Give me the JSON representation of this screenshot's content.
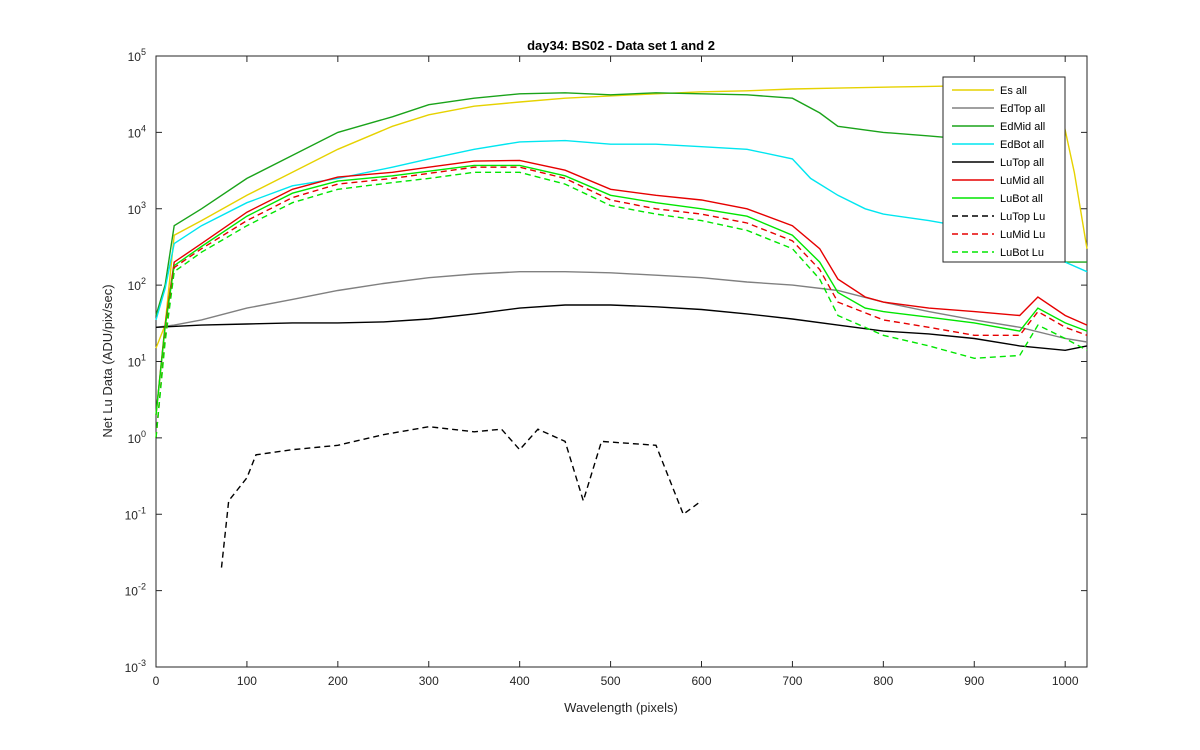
{
  "chart_data": {
    "type": "line",
    "title": "day34: BS02 - Data set 1 and 2",
    "xlabel": "Wavelength (pixels)",
    "ylabel": "Net Lu Data (ADU/pix/sec)",
    "xlim": [
      0,
      1024
    ],
    "ylim": [
      0.001,
      100000
    ],
    "yscale": "log",
    "x_ticks": [
      "0",
      "100",
      "200",
      "300",
      "400",
      "500",
      "600",
      "700",
      "800",
      "900",
      "1000"
    ],
    "y_tick_bases": [
      "10",
      "10",
      "10",
      "10",
      "10",
      "10",
      "10",
      "10",
      "10"
    ],
    "y_tick_exponents": [
      "-3",
      "-2",
      "-1",
      "0",
      "1",
      "2",
      "3",
      "4",
      "5"
    ],
    "grid": false,
    "legend_position": "top-right",
    "series": [
      {
        "name": "Es  all",
        "color": "#e6d200",
        "style": "solid",
        "points": [
          [
            0,
            15
          ],
          [
            10,
            30
          ],
          [
            20,
            450
          ],
          [
            50,
            700
          ],
          [
            100,
            1500
          ],
          [
            150,
            3000
          ],
          [
            200,
            6000
          ],
          [
            260,
            12000
          ],
          [
            300,
            17000
          ],
          [
            350,
            22000
          ],
          [
            400,
            25000
          ],
          [
            450,
            28000
          ],
          [
            500,
            30000
          ],
          [
            550,
            32000
          ],
          [
            600,
            34000
          ],
          [
            650,
            35000
          ],
          [
            700,
            37000
          ],
          [
            750,
            38000
          ],
          [
            800,
            39000
          ],
          [
            850,
            40000
          ],
          [
            900,
            41000
          ],
          [
            950,
            40000
          ],
          [
            990,
            38000
          ],
          [
            1010,
            3000
          ],
          [
            1024,
            300
          ]
        ]
      },
      {
        "name": "EdTop  all",
        "color": "#808080",
        "style": "solid",
        "points": [
          [
            0,
            28
          ],
          [
            20,
            30
          ],
          [
            50,
            35
          ],
          [
            100,
            50
          ],
          [
            150,
            65
          ],
          [
            200,
            85
          ],
          [
            250,
            105
          ],
          [
            300,
            125
          ],
          [
            350,
            140
          ],
          [
            400,
            150
          ],
          [
            450,
            150
          ],
          [
            500,
            145
          ],
          [
            550,
            135
          ],
          [
            600,
            125
          ],
          [
            650,
            110
          ],
          [
            700,
            100
          ],
          [
            750,
            85
          ],
          [
            800,
            60
          ],
          [
            850,
            45
          ],
          [
            900,
            35
          ],
          [
            950,
            28
          ],
          [
            1000,
            20
          ],
          [
            1024,
            18
          ]
        ]
      },
      {
        "name": "EdMid  all",
        "color": "#1aa31a",
        "style": "solid",
        "points": [
          [
            0,
            40
          ],
          [
            10,
            100
          ],
          [
            20,
            600
          ],
          [
            50,
            1000
          ],
          [
            100,
            2500
          ],
          [
            150,
            5000
          ],
          [
            200,
            10000
          ],
          [
            260,
            16000
          ],
          [
            300,
            23000
          ],
          [
            350,
            28000
          ],
          [
            400,
            32000
          ],
          [
            450,
            33000
          ],
          [
            500,
            31000
          ],
          [
            550,
            33000
          ],
          [
            600,
            32000
          ],
          [
            650,
            31000
          ],
          [
            700,
            28000
          ],
          [
            730,
            18000
          ],
          [
            750,
            12000
          ],
          [
            800,
            10000
          ],
          [
            850,
            9000
          ],
          [
            900,
            8000
          ],
          [
            950,
            7000
          ],
          [
            980,
            4000
          ],
          [
            1000,
            200
          ],
          [
            1024,
            200
          ]
        ]
      },
      {
        "name": "EdBot  all",
        "color": "#00e6f0",
        "style": "solid",
        "points": [
          [
            0,
            35
          ],
          [
            10,
            90
          ],
          [
            20,
            350
          ],
          [
            50,
            600
          ],
          [
            100,
            1200
          ],
          [
            150,
            2000
          ],
          [
            200,
            2500
          ],
          [
            260,
            3500
          ],
          [
            300,
            4500
          ],
          [
            350,
            6000
          ],
          [
            400,
            7500
          ],
          [
            450,
            7800
          ],
          [
            500,
            7000
          ],
          [
            550,
            7000
          ],
          [
            600,
            6500
          ],
          [
            650,
            6000
          ],
          [
            700,
            4500
          ],
          [
            720,
            2500
          ],
          [
            750,
            1500
          ],
          [
            780,
            1000
          ],
          [
            800,
            850
          ],
          [
            850,
            700
          ],
          [
            900,
            550
          ],
          [
            950,
            400
          ],
          [
            1000,
            200
          ],
          [
            1024,
            150
          ]
        ]
      },
      {
        "name": "LuTop  all",
        "color": "#000000",
        "style": "solid",
        "points": [
          [
            0,
            28
          ],
          [
            50,
            30
          ],
          [
            100,
            31
          ],
          [
            150,
            32
          ],
          [
            200,
            32
          ],
          [
            250,
            33
          ],
          [
            300,
            36
          ],
          [
            350,
            42
          ],
          [
            400,
            50
          ],
          [
            450,
            55
          ],
          [
            500,
            55
          ],
          [
            550,
            52
          ],
          [
            600,
            48
          ],
          [
            650,
            42
          ],
          [
            700,
            36
          ],
          [
            750,
            30
          ],
          [
            800,
            25
          ],
          [
            850,
            23
          ],
          [
            900,
            20
          ],
          [
            950,
            16
          ],
          [
            1000,
            14
          ],
          [
            1024,
            16
          ]
        ]
      },
      {
        "name": "LuMid  all",
        "color": "#e60000",
        "style": "solid",
        "points": [
          [
            0,
            2
          ],
          [
            10,
            30
          ],
          [
            20,
            200
          ],
          [
            50,
            350
          ],
          [
            100,
            900
          ],
          [
            150,
            1800
          ],
          [
            200,
            2600
          ],
          [
            260,
            3000
          ],
          [
            300,
            3500
          ],
          [
            350,
            4200
          ],
          [
            400,
            4300
          ],
          [
            450,
            3200
          ],
          [
            500,
            1800
          ],
          [
            550,
            1500
          ],
          [
            600,
            1300
          ],
          [
            650,
            1000
          ],
          [
            700,
            600
          ],
          [
            730,
            300
          ],
          [
            750,
            120
          ],
          [
            780,
            70
          ],
          [
            800,
            60
          ],
          [
            850,
            50
          ],
          [
            900,
            45
          ],
          [
            950,
            40
          ],
          [
            970,
            70
          ],
          [
            1000,
            40
          ],
          [
            1024,
            30
          ]
        ]
      },
      {
        "name": "LuBot  all",
        "color": "#00e600",
        "style": "solid",
        "points": [
          [
            0,
            2
          ],
          [
            10,
            28
          ],
          [
            20,
            180
          ],
          [
            50,
            320
          ],
          [
            100,
            800
          ],
          [
            150,
            1600
          ],
          [
            200,
            2300
          ],
          [
            260,
            2700
          ],
          [
            300,
            3100
          ],
          [
            350,
            3700
          ],
          [
            400,
            3700
          ],
          [
            450,
            2700
          ],
          [
            500,
            1500
          ],
          [
            550,
            1200
          ],
          [
            600,
            1000
          ],
          [
            650,
            800
          ],
          [
            700,
            450
          ],
          [
            730,
            200
          ],
          [
            750,
            80
          ],
          [
            780,
            50
          ],
          [
            800,
            45
          ],
          [
            850,
            38
          ],
          [
            900,
            32
          ],
          [
            950,
            25
          ],
          [
            970,
            50
          ],
          [
            1000,
            32
          ],
          [
            1024,
            25
          ]
        ]
      },
      {
        "name": "LuTop  Lu",
        "color": "#000000",
        "style": "dashed",
        "points": [
          [
            72,
            0.02
          ],
          [
            80,
            0.15
          ],
          [
            100,
            0.3
          ],
          [
            110,
            0.6
          ],
          [
            150,
            0.7
          ],
          [
            200,
            0.8
          ],
          [
            250,
            1.1
          ],
          [
            300,
            1.4
          ],
          [
            350,
            1.2
          ],
          [
            380,
            1.3
          ],
          [
            400,
            0.7
          ],
          [
            420,
            1.3
          ],
          [
            450,
            0.9
          ],
          [
            470,
            0.15
          ],
          [
            490,
            0.9
          ],
          [
            550,
            0.8
          ],
          [
            580,
            0.1
          ],
          [
            600,
            0.15
          ]
        ]
      },
      {
        "name": "LuMid  Lu",
        "color": "#e60000",
        "style": "dashed",
        "points": [
          [
            0,
            1
          ],
          [
            10,
            20
          ],
          [
            20,
            170
          ],
          [
            50,
            300
          ],
          [
            100,
            700
          ],
          [
            150,
            1400
          ],
          [
            200,
            2100
          ],
          [
            260,
            2500
          ],
          [
            300,
            2900
          ],
          [
            350,
            3500
          ],
          [
            400,
            3500
          ],
          [
            450,
            2500
          ],
          [
            500,
            1300
          ],
          [
            550,
            1000
          ],
          [
            600,
            850
          ],
          [
            650,
            650
          ],
          [
            700,
            380
          ],
          [
            730,
            160
          ],
          [
            750,
            60
          ],
          [
            800,
            35
          ],
          [
            850,
            28
          ],
          [
            900,
            22
          ],
          [
            950,
            22
          ],
          [
            970,
            45
          ],
          [
            1000,
            28
          ],
          [
            1024,
            22
          ]
        ]
      },
      {
        "name": "LuBot  Lu",
        "color": "#00e600",
        "style": "dashed",
        "points": [
          [
            0,
            1
          ],
          [
            10,
            18
          ],
          [
            20,
            150
          ],
          [
            50,
            270
          ],
          [
            100,
            600
          ],
          [
            150,
            1200
          ],
          [
            200,
            1800
          ],
          [
            260,
            2200
          ],
          [
            300,
            2500
          ],
          [
            350,
            3000
          ],
          [
            400,
            3000
          ],
          [
            450,
            2100
          ],
          [
            500,
            1100
          ],
          [
            550,
            850
          ],
          [
            600,
            700
          ],
          [
            650,
            520
          ],
          [
            700,
            300
          ],
          [
            730,
            120
          ],
          [
            750,
            40
          ],
          [
            800,
            22
          ],
          [
            850,
            16
          ],
          [
            900,
            11
          ],
          [
            950,
            12
          ],
          [
            970,
            30
          ],
          [
            1000,
            20
          ],
          [
            1024,
            14
          ]
        ]
      }
    ]
  }
}
